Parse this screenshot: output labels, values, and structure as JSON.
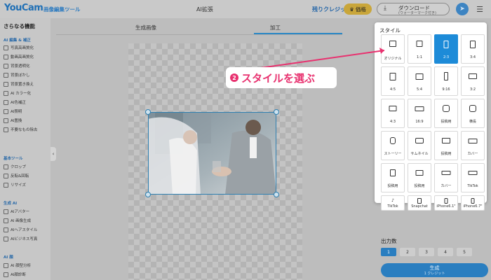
{
  "header": {
    "logo": "YouCam",
    "logo_sub": "画像編集ツール",
    "title": "AI拡張",
    "credits": "残りクレジット：0",
    "price_label": "価格",
    "download_label": "ダウンロード",
    "download_sub": "(ウォーターマーク付き)"
  },
  "sidebar": {
    "title": "さらなる機能",
    "sections": [
      {
        "label": "AI 編集 & 補正",
        "items": [
          "写真高画質化",
          "動画高画質化",
          "背景透明化",
          "背景ぼかし",
          "背景置き換え",
          "AI カラー化",
          "AI色補正",
          "AI照明",
          "AI置換",
          "不要なもの除去"
        ]
      },
      {
        "label": "基本ツール",
        "items": [
          "クロップ",
          "反転&回転",
          "リサイズ"
        ]
      },
      {
        "label": "生成 AI",
        "items": [
          "AIアバター",
          "AI 画像生成",
          "AIヘアスタイル",
          "AIビジネス写真"
        ]
      },
      {
        "label": "AI 顔",
        "items": [
          "AI 顔型分析",
          "AI顔診断"
        ]
      }
    ]
  },
  "tabs": [
    "生成画像",
    "加工"
  ],
  "style_panel": {
    "title": "スタイル",
    "options": [
      "オリジナル",
      "1:1",
      "2:3",
      "3:4",
      "4:5",
      "5:4",
      "9:16",
      "3:2",
      "4:3",
      "16:9",
      "投稿用",
      "横長",
      "ストーリー",
      "サムネイル",
      "投稿用",
      "カバー",
      "投稿用",
      "投稿用",
      "カバー",
      "TikTok",
      "TikTok",
      "Snapchat",
      "iPhone6.1\"",
      "iPhone6.7\""
    ],
    "selected": "2:3"
  },
  "annotation": {
    "number": "2",
    "text": "スタイルを選ぶ",
    "color": "#e8316f"
  },
  "output": {
    "label": "出力数",
    "options": [
      "1",
      "2",
      "3",
      "4",
      "5"
    ],
    "selected": "1"
  },
  "generate": {
    "label": "生成",
    "sub": "1 クレジット"
  },
  "colors": {
    "accent": "#2a7ec0",
    "selected_cell": "#1d8bd8",
    "annotation": "#e8316f"
  }
}
